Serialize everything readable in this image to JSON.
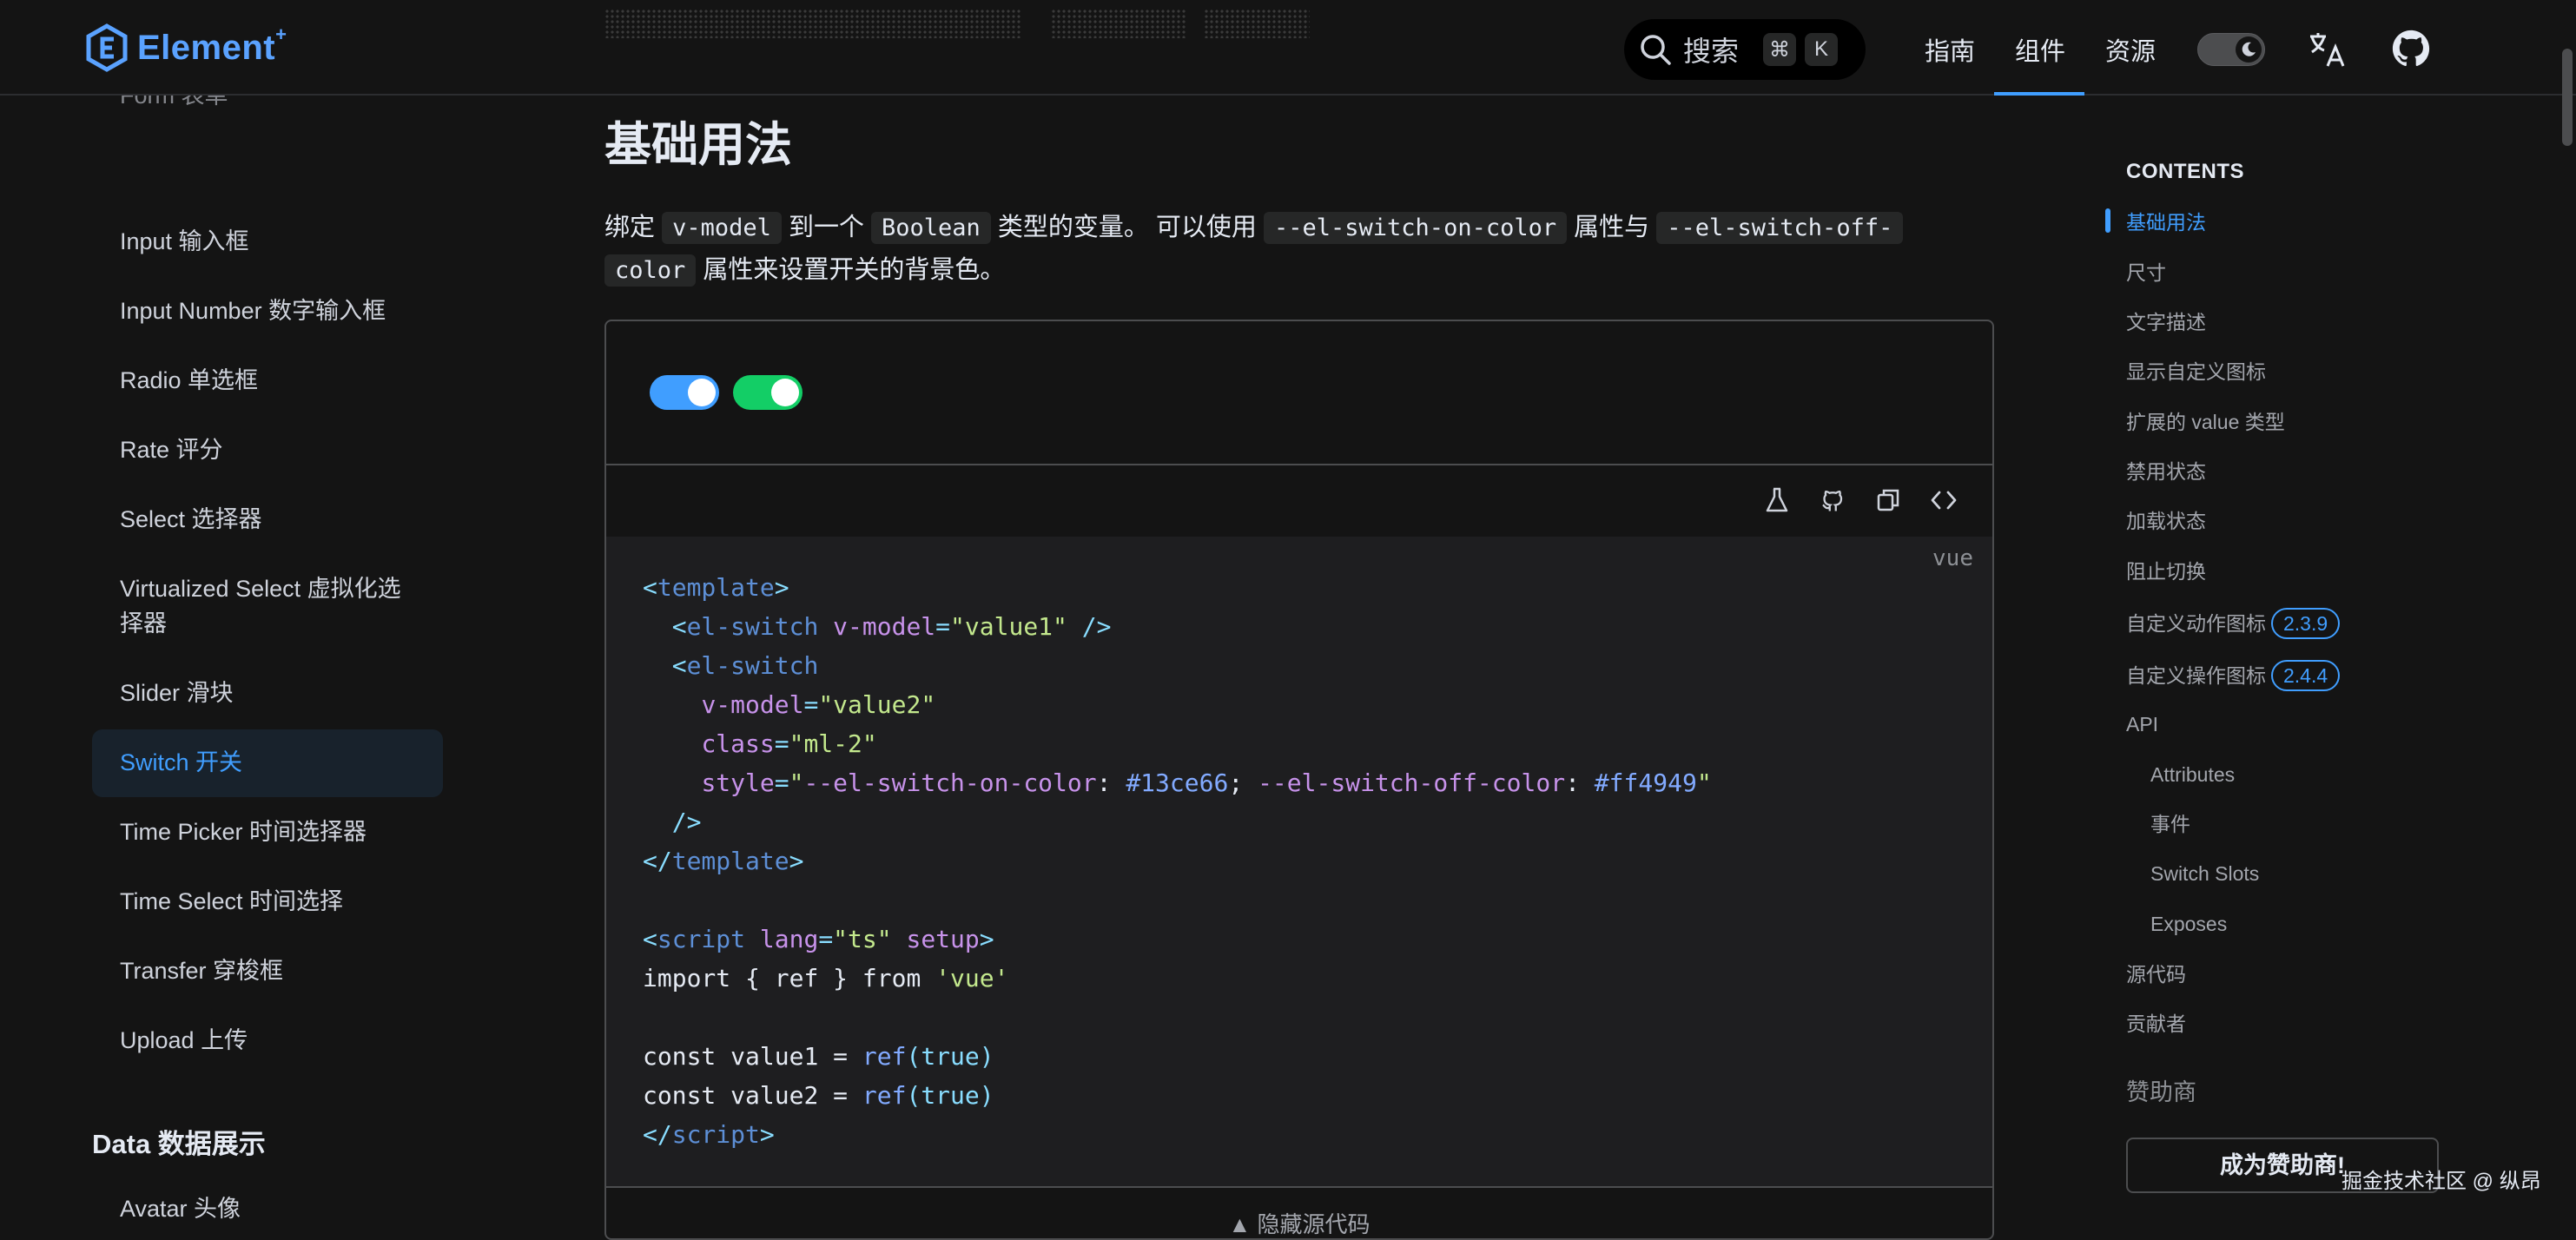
{
  "header": {
    "logo_text": "Element",
    "logo_sup": "+",
    "search_label": "搜索",
    "search_shortcut_mod": "⌘",
    "search_shortcut_key": "K",
    "nav": [
      {
        "label": "指南"
      },
      {
        "label": "组件",
        "active": true
      },
      {
        "label": "资源"
      }
    ]
  },
  "sidebar": {
    "items": [
      "Input 输入框",
      "Input Number 数字输入框",
      "Radio 单选框",
      "Rate 评分",
      "Select 选择器",
      "Virtualized Select 虚拟化选",
      "择器",
      "Slider 滑块",
      "Switch 开关",
      "Time Picker 时间选择器",
      "Time Select 时间选择",
      "Transfer 穿梭框",
      "Upload 上传"
    ],
    "group_title": "Data 数据展示",
    "next_item": "Avatar 头像",
    "active_index": 8
  },
  "main": {
    "heading": "基础用法",
    "desc": {
      "p1": "绑定",
      "c1": "v-model",
      "p2": "到一个",
      "c2": "Boolean",
      "p3": "类型的变量。 可以使用",
      "c3": "--el-switch-on-color",
      "p4": "属性与",
      "c4a": "--el-switch-off-",
      "c4b": "color",
      "p5": "属性来设置开关的背景色。"
    },
    "switch_colors": {
      "first": "#409eff",
      "second": "#13ce66"
    },
    "code_lang": "vue",
    "code": {
      "l1_tag": "template",
      "l2_tag": "el-switch",
      "l2_attr": "v-model",
      "l2_val": "\"value1\"",
      "l3_tag": "el-switch",
      "l4_attr": "v-model",
      "l4_val": "\"value2\"",
      "l5_attr": "class",
      "l5_val": "\"ml-2\"",
      "l6_attr": "style",
      "l6_q": "\"",
      "l6_p1": "--el-switch-on-color",
      "l6_v1": "#13ce66",
      "l6_p2": "--el-switch-off-color",
      "l6_v2": "#ff4949",
      "l8_tag": "template",
      "l10_tag": "script",
      "l10_attr1": "lang",
      "l10_val1": "\"ts\"",
      "l10_attr2": "setup",
      "l11_import": "import",
      "l11_mid": " { ref } ",
      "l11_from": "from",
      "l11_mod": "'vue'",
      "l13_const": "const",
      "l13_name": " value1 = ",
      "l14_name": " value2 = ",
      "ref_fn": "ref",
      "bool_true": "true",
      "l15_tag": "script"
    },
    "hide_source_label": "隐藏源代码"
  },
  "toc": {
    "title": "CONTENTS",
    "items": [
      {
        "label": "基础用法",
        "active": true
      },
      {
        "label": "尺寸"
      },
      {
        "label": "文字描述"
      },
      {
        "label": "显示自定义图标"
      },
      {
        "label": "扩展的 value 类型"
      },
      {
        "label": "禁用状态"
      },
      {
        "label": "加载状态"
      },
      {
        "label": "阻止切换"
      },
      {
        "label": "自定义动作图标",
        "badge": "2.3.9"
      },
      {
        "label": "自定义操作图标",
        "badge": "2.4.4"
      },
      {
        "label": "API"
      },
      {
        "label": "Attributes",
        "sub": true
      },
      {
        "label": "事件",
        "sub": true
      },
      {
        "label": "Switch Slots",
        "sub": true
      },
      {
        "label": "Exposes",
        "sub": true
      },
      {
        "label": "源代码"
      },
      {
        "label": "贡献者"
      }
    ],
    "sponsor_label": "赞助商",
    "sponsor_button": "成为赞助商!"
  },
  "watermark": "掘金技术社区 @ 纵昂"
}
